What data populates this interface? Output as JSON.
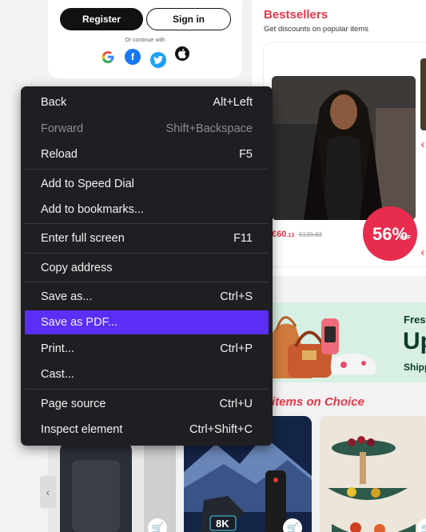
{
  "login": {
    "register_label": "Register",
    "signin_label": "Sign in",
    "continue_text": "Or continue with",
    "social_icons": [
      "google-icon",
      "facebook-icon",
      "twitter-icon",
      "apple-icon"
    ]
  },
  "bestsellers": {
    "title": "Bestsellers",
    "subtitle": "Get discounts on popular items",
    "product": {
      "price_main": "€60",
      "price_cents": ".13",
      "old_price": "€139.83",
      "discount_num": "56%",
      "discount_off": "OFF"
    },
    "edge_prices": [
      "€",
      "€"
    ]
  },
  "banner": {
    "line1": "Fres",
    "line2": "Up",
    "line3": "Shipp"
  },
  "choice": {
    "title": "items on Choice"
  },
  "context_menu": {
    "items": [
      {
        "label": "Back",
        "shortcut": "Alt+Left",
        "disabled": false
      },
      {
        "label": "Forward",
        "shortcut": "Shift+Backspace",
        "disabled": true
      },
      {
        "label": "Reload",
        "shortcut": "F5",
        "disabled": false
      },
      {
        "label": "Add to Speed Dial",
        "shortcut": "",
        "disabled": false
      },
      {
        "label": "Add to bookmarks...",
        "shortcut": "",
        "disabled": false
      },
      {
        "label": "Enter full screen",
        "shortcut": "F11",
        "disabled": false
      },
      {
        "label": "Copy address",
        "shortcut": "",
        "disabled": false
      },
      {
        "label": "Save as...",
        "shortcut": "Ctrl+S",
        "disabled": false
      },
      {
        "label": "Save as PDF...",
        "shortcut": "",
        "disabled": false,
        "highlighted": true
      },
      {
        "label": "Print...",
        "shortcut": "Ctrl+P",
        "disabled": false
      },
      {
        "label": "Cast...",
        "shortcut": "",
        "disabled": false
      },
      {
        "label": "Page source",
        "shortcut": "Ctrl+U",
        "disabled": false
      },
      {
        "label": "Inspect element",
        "shortcut": "Ctrl+Shift+C",
        "disabled": false
      }
    ]
  },
  "bottom_cards": {
    "tv_badge": "8K"
  },
  "colors": {
    "accent": "#e8374a",
    "menu_bg": "#1f1f23",
    "menu_highlight": "#5b2ef5",
    "discount": "#e82c4e"
  }
}
